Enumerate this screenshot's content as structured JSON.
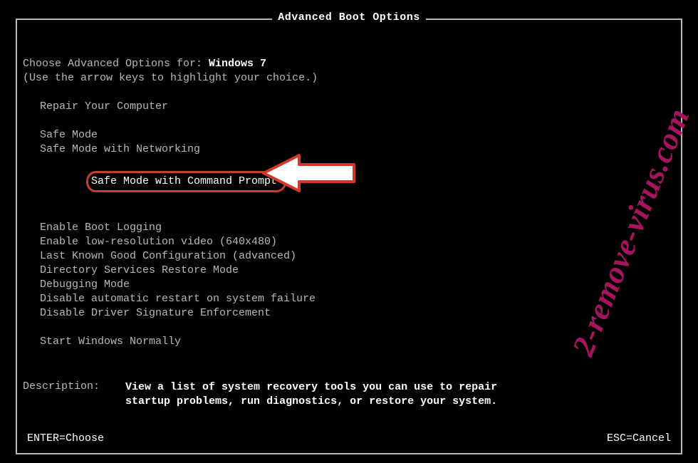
{
  "title": "Advanced Boot Options",
  "choose_prefix": "Choose Advanced Options for: ",
  "os_name": "Windows 7",
  "hint": "(Use the arrow keys to highlight your choice.)",
  "groups": {
    "g1": [
      "Repair Your Computer"
    ],
    "g2": [
      "Safe Mode",
      "Safe Mode with Networking",
      "Safe Mode with Command Prompt"
    ],
    "g3": [
      "Enable Boot Logging",
      "Enable low-resolution video (640x480)",
      "Last Known Good Configuration (advanced)",
      "Directory Services Restore Mode",
      "Debugging Mode",
      "Disable automatic restart on system failure",
      "Disable Driver Signature Enforcement"
    ],
    "g4": [
      "Start Windows Normally"
    ]
  },
  "highlighted_option": "Safe Mode with Command Prompt",
  "description_label": "Description:    ",
  "description_text": "View a list of system recovery tools you can use to repair startup problems, run diagnostics, or restore your system.",
  "footer": {
    "enter": "ENTER=Choose",
    "esc": "ESC=Cancel"
  },
  "watermark": "2-remove-virus.com"
}
